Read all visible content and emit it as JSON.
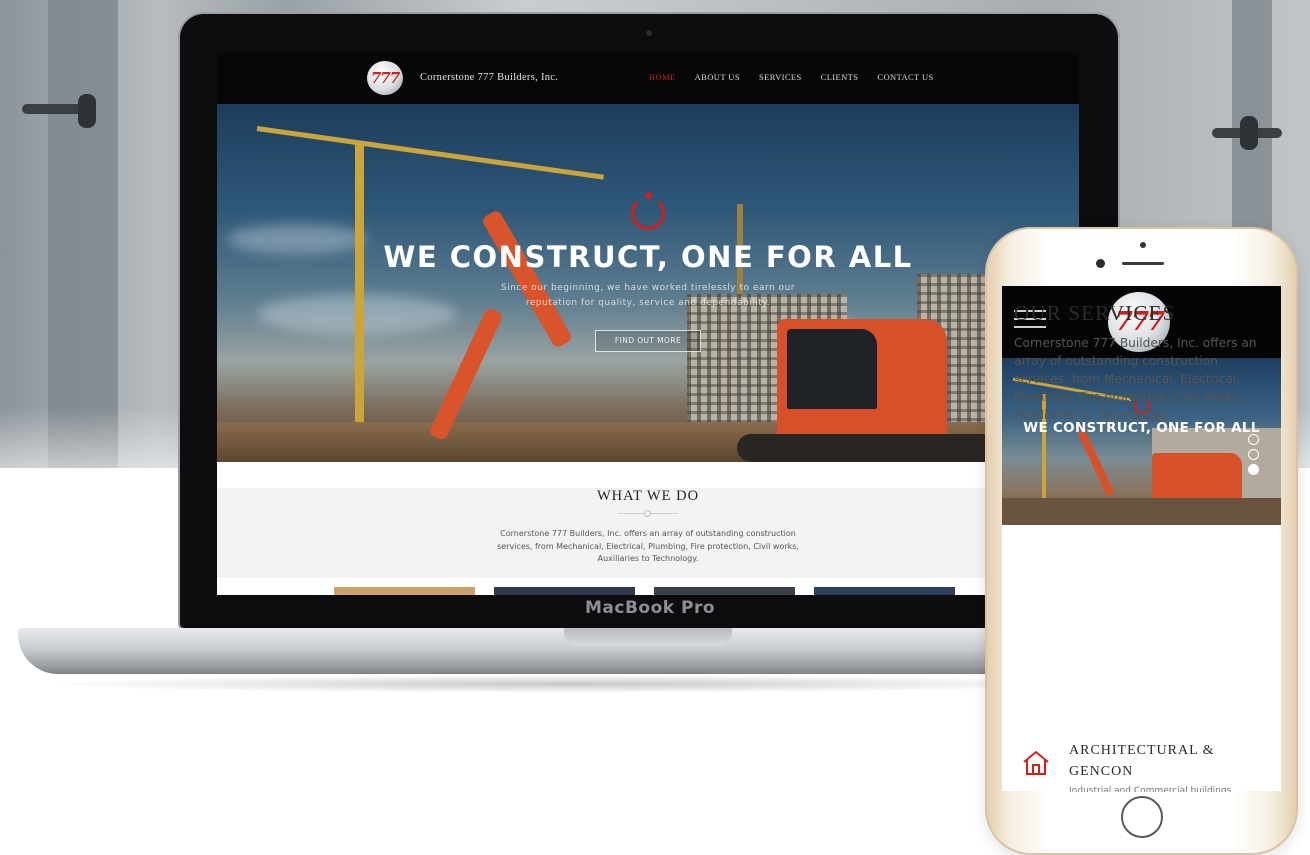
{
  "laptop": {
    "label": "MacBook Pro"
  },
  "desktop_site": {
    "logo_text": "777",
    "brand": "Cornerstone 777 Builders, Inc.",
    "menu": [
      {
        "label": "HOME",
        "active": true
      },
      {
        "label": "ABOUT US",
        "active": false
      },
      {
        "label": "SERVICES",
        "active": false
      },
      {
        "label": "CLIENTS",
        "active": false
      },
      {
        "label": "CONTACT US",
        "active": false
      }
    ],
    "hero": {
      "title": "WE CONSTRUCT, ONE FOR ALL",
      "subtitle": "Since our beginning, we have worked tirelessly to earn our reputation for quality, service and dependability.",
      "button": "FIND OUT MORE"
    },
    "what_we_do": {
      "title": "WHAT WE DO",
      "text": "Cornerstone 777 Builders, Inc. offers an array of outstanding construction services, from Mechanical, Electrical, Plumbing, Fire protection, Civil works, Auxiliaries to Technology."
    }
  },
  "mobile_site": {
    "logo_text": "777",
    "hero": {
      "title": "WE CONSTRUCT, ONE FOR ALL",
      "slides": 3,
      "active_slide": 3
    },
    "services": {
      "title": "OUR SERVICES",
      "text": "Cornerstone 777 Builders, Inc. offers an array of outstanding construction services, from Mechanical, Electrical, Plumbing, Fire protection, Civil works, Auxiliaries to Technology.",
      "items": [
        {
          "icon": "home-icon",
          "title": "ARCHITECTURAL & GENCON",
          "text": "Industrial and Commercial buildings"
        }
      ]
    }
  },
  "colors": {
    "accent": "#d0201c",
    "nav_bg": "#070707",
    "phone_gold": "#e4cfb0"
  }
}
